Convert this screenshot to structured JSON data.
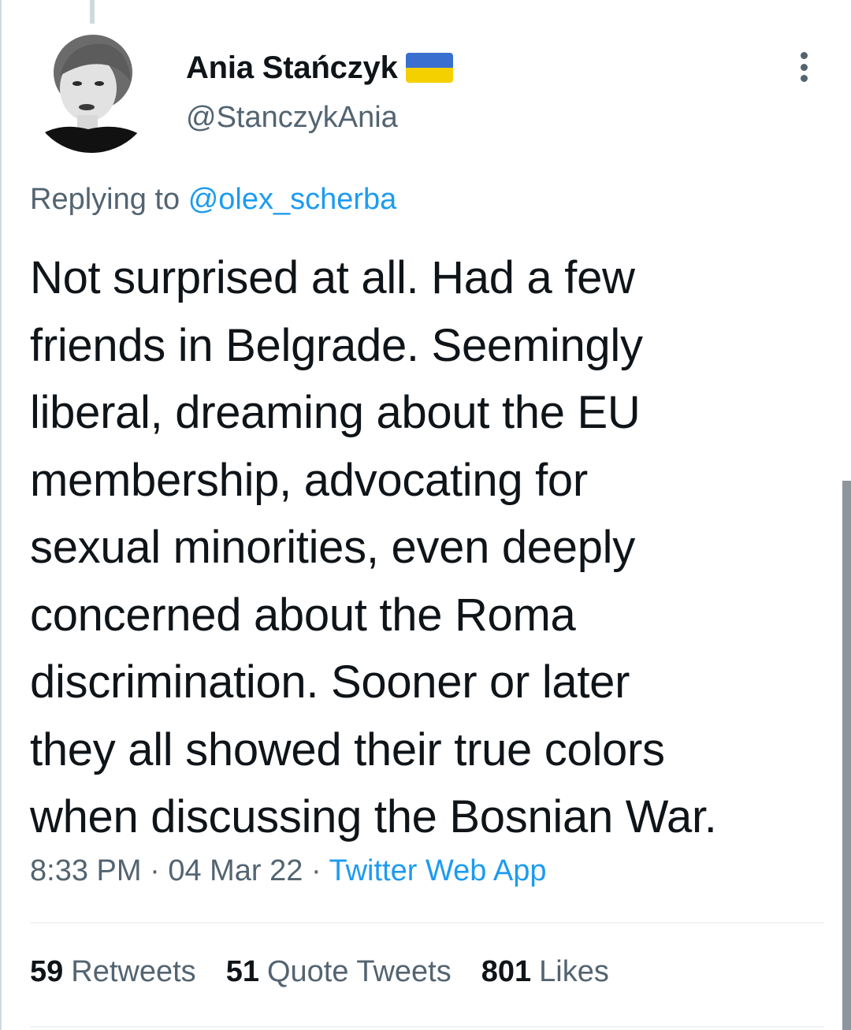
{
  "tweet": {
    "author": {
      "display_name": "Ania Stańczyk",
      "handle": "@StanczykAnia",
      "flag_colors": [
        "#3a6fd0",
        "#f5d000"
      ]
    },
    "reply": {
      "prefix": "Replying to",
      "mention": "@olex_scherba"
    },
    "text_lines": [
      "Not surprised at all. Had a few",
      "friends in Belgrade. Seemingly",
      "liberal, dreaming about the EU",
      "membership, advocating for",
      "sexual minorities, even deeply",
      "concerned about the Roma",
      "discrimination. Sooner or later",
      "they all showed their true colors",
      "when discussing the Bosnian War."
    ],
    "meta": {
      "time": "8:33 PM",
      "sep1": " · ",
      "date": "04 Mar 22",
      "sep2": " · ",
      "source": "Twitter Web App"
    },
    "stats": {
      "retweets": {
        "count": "59",
        "label": "Retweets"
      },
      "quotes": {
        "count": "51",
        "label": "Quote Tweets"
      },
      "likes": {
        "count": "801",
        "label": "Likes"
      }
    }
  },
  "colors": {
    "text": "#0f1419",
    "secondary": "#536471",
    "link": "#1d9bf0",
    "divider": "#eff3f4"
  }
}
